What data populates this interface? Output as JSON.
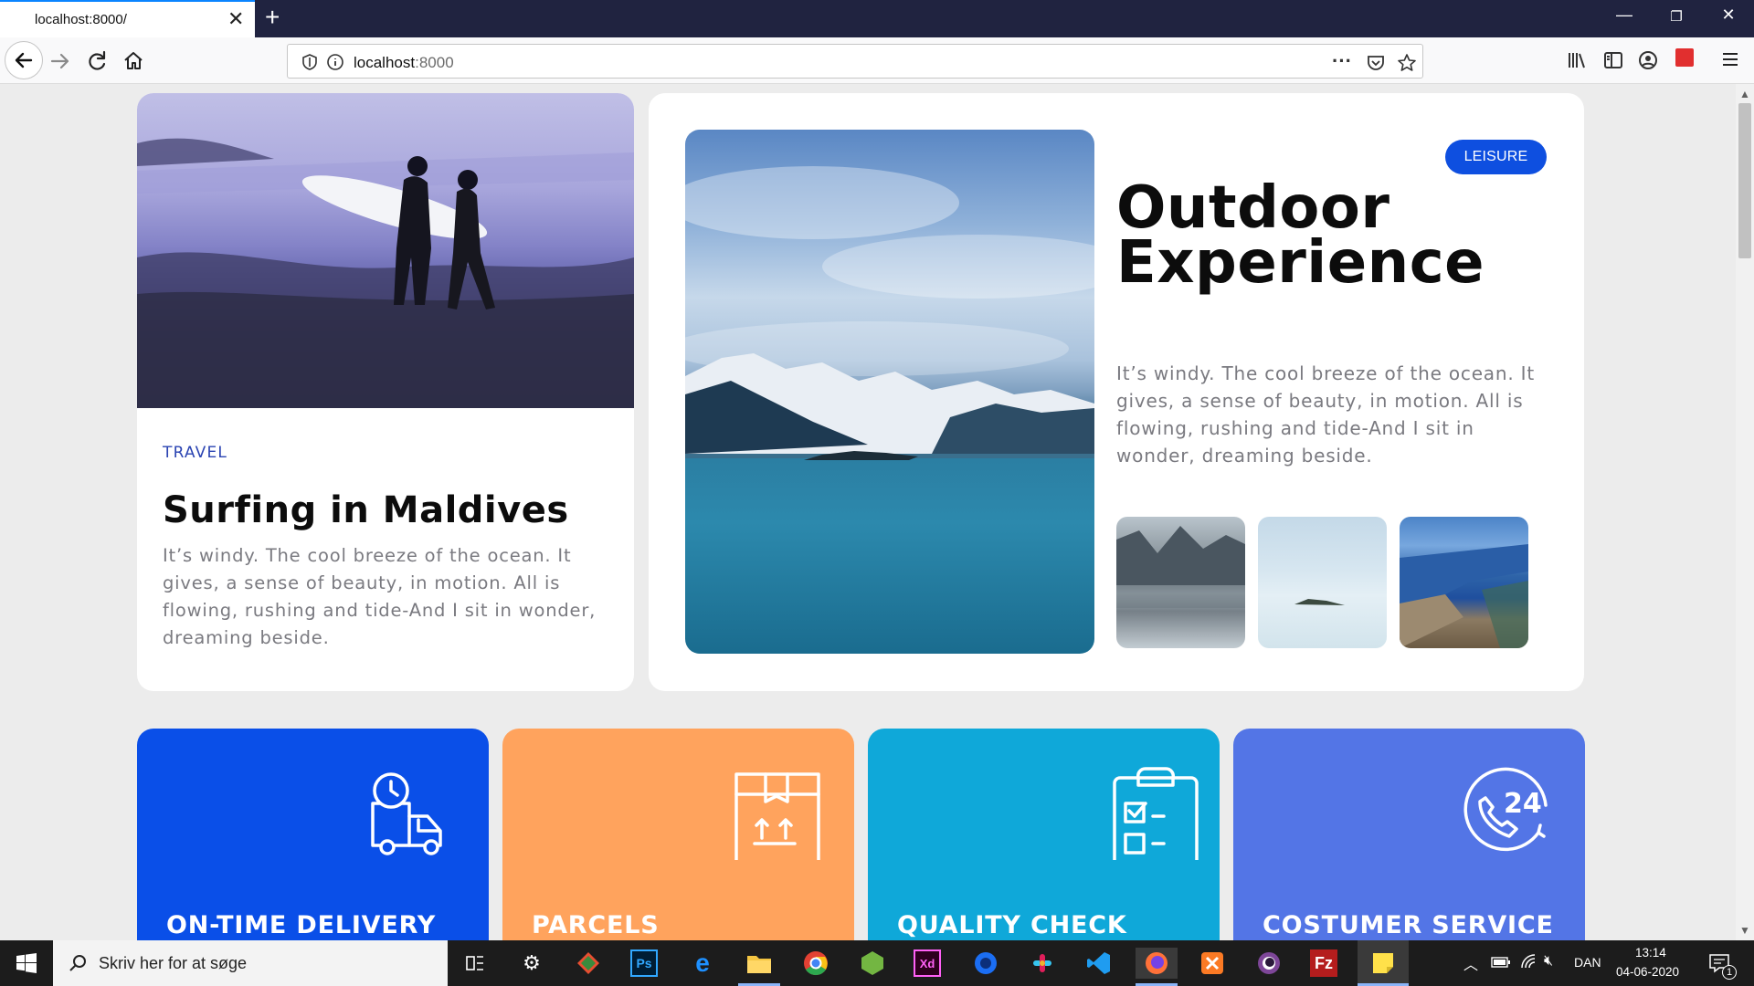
{
  "browser": {
    "tab_title": "localhost:8000/",
    "url_host": "localhost",
    "url_port": ":8000"
  },
  "cards": {
    "small": {
      "tag": "TRAVEL",
      "title": "Surfing in Maldives",
      "text": "It’s windy. The cool breeze of the ocean. It gives, a sense of beauty, in motion. All is flowing, rushing and tide-And I sit in wonder, dreaming beside."
    },
    "big": {
      "badge": "LEISURE",
      "title_line1": "Outdoor",
      "title_line2": "Experience",
      "text": "It’s windy. The cool breeze of the ocean. It gives, a sense of beauty, in motion. All is flowing, rushing and tide-And I sit in wonder, dreaming beside."
    }
  },
  "features": [
    {
      "title": "ON-TIME DELIVERY",
      "color": "#0a4fe8",
      "icon": "delivery-truck-icon"
    },
    {
      "title": "PARCELS",
      "color": "#ffa35d",
      "icon": "parcel-box-icon"
    },
    {
      "title": "QUALITY CHECK",
      "color": "#0fa8d9",
      "icon": "clipboard-check-icon"
    },
    {
      "title": "COSTUMER SERVICE",
      "color": "#5375e6",
      "icon": "support-24-icon"
    }
  ],
  "taskbar": {
    "search_placeholder": "Skriv her for at søge",
    "language": "DAN",
    "time": "13:14",
    "date": "04-06-2020",
    "notification_count": "1"
  }
}
